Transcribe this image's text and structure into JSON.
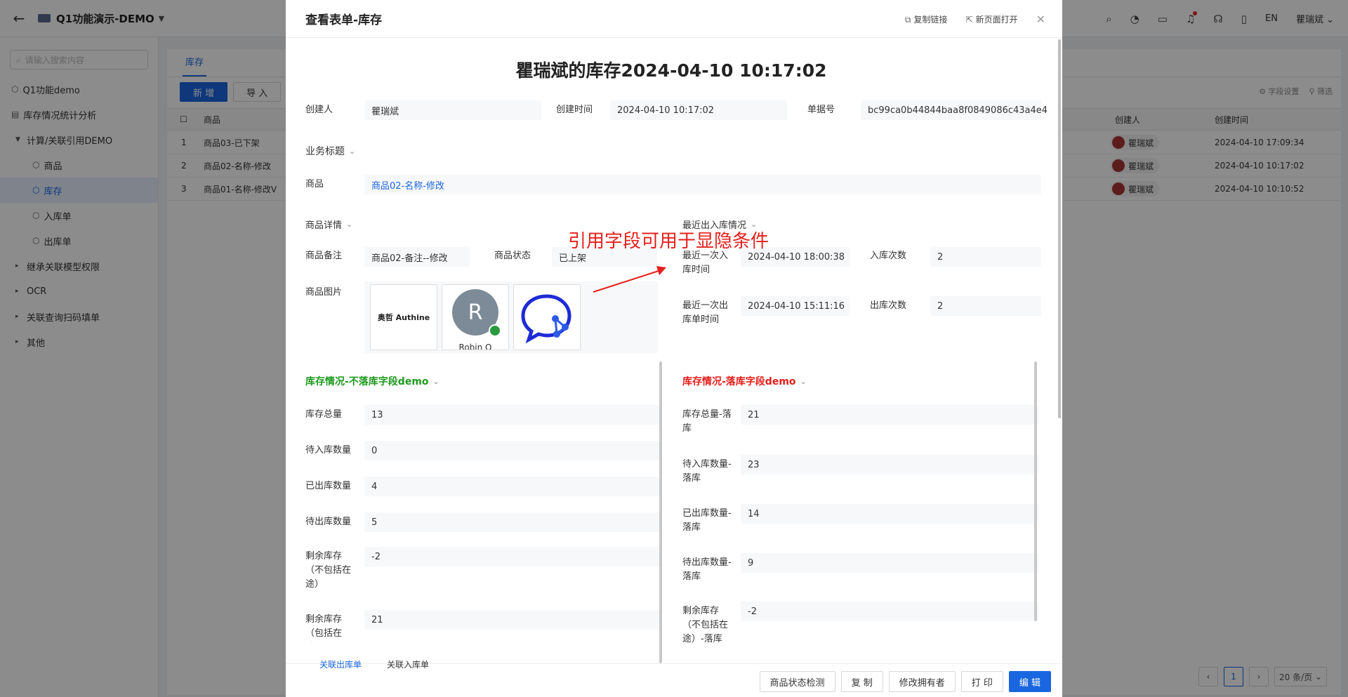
{
  "topbar": {
    "title": "Q1功能演示-DEMO",
    "lang": "EN",
    "user": "瞿瑞斌",
    "icons": [
      "search-icon",
      "dashboard-icon",
      "monitor-icon",
      "bell-icon",
      "headset-icon",
      "book-icon"
    ]
  },
  "sidebar": {
    "search_placeholder": "请输入搜索内容",
    "items": [
      {
        "label": "Q1功能demo"
      },
      {
        "label": "库存情况统计分析"
      },
      {
        "label": "计算/关联引用DEMO"
      },
      {
        "label": "商品"
      },
      {
        "label": "库存"
      },
      {
        "label": "入库单"
      },
      {
        "label": "出库单"
      },
      {
        "label": "继承关联模型权限"
      },
      {
        "label": "OCR"
      },
      {
        "label": "关联查询扫码填单"
      },
      {
        "label": "其他"
      }
    ]
  },
  "list": {
    "tab": "库存",
    "add": "新 增",
    "import": "导 入",
    "field_settings": "字段设置",
    "filter": "筛选",
    "col_product": "商品",
    "col_creator": "创建人",
    "col_created": "创建时间",
    "rows": [
      {
        "no": "1",
        "product": "商品03-已下架",
        "creator": "瞿瑞斌",
        "created": "2024-04-10 17:09:34"
      },
      {
        "no": "2",
        "product": "商品02-名称-修改",
        "creator": "瞿瑞斌",
        "created": "2024-04-10 10:17:02"
      },
      {
        "no": "3",
        "product": "商品01-名称-修改V",
        "creator": "瞿瑞斌",
        "created": "2024-04-10 10:10:52"
      }
    ],
    "page": "1",
    "page_size": "20 条/页"
  },
  "modal": {
    "title": "查看表单-库存",
    "copy_link": "复制链接",
    "open_new": "新页面打开",
    "doc_title": "瞿瑞斌的库存2024-04-10 10:17:02",
    "creator_label": "创建人",
    "creator": "瞿瑞斌",
    "created_label": "创建时间",
    "created": "2024-04-10 10:17:02",
    "docno_label": "单据号",
    "docno": "bc99ca0b44844baa8f0849086c43a4e4",
    "biz_title": "业务标题",
    "product_label": "商品",
    "product": "商品02-名称-修改",
    "product_detail": "商品详情",
    "product_note_label": "商品备注",
    "product_note": "商品02-备注--修改",
    "product_status_label": "商品状态",
    "product_status": "已上架",
    "product_image_label": "商品图片",
    "image_logo_text": "奥哲 Authine",
    "image_avatar_letter": "R",
    "image_avatar_name": "Robin Q",
    "recent_title": "最近出入库情况",
    "last_in_label": "最近一次入库时间",
    "last_in": "2024-04-10 18:00:38",
    "in_count_label": "入库次数",
    "in_count": "2",
    "last_out_label": "最近一次出库单时间",
    "last_out": "2024-04-10 15:11:16",
    "out_count_label": "出库次数",
    "out_count": "2",
    "annotation": "引用字段可用于显隐条件",
    "left_section": "库存情况-不落库字段demo",
    "right_section": "库存情况-落库字段demo",
    "left_fields": [
      {
        "label": "库存总量",
        "value": "13"
      },
      {
        "label": "待入库数量",
        "value": "0"
      },
      {
        "label": "已出库数量",
        "value": "4"
      },
      {
        "label": "待出库数量",
        "value": "5"
      },
      {
        "label": "剩余库存（不包括在途）",
        "value": "-2"
      },
      {
        "label": "剩余库存（包括在途）",
        "value": "21"
      }
    ],
    "right_fields": [
      {
        "label": "库存总量-落库",
        "value": "21"
      },
      {
        "label": "待入库数量-落库",
        "value": "23"
      },
      {
        "label": "已出库数量-落库",
        "value": "14"
      },
      {
        "label": "待出库数量-落库",
        "value": "9"
      },
      {
        "label": "剩余库存（不包括在途）-落库",
        "value": "-2"
      }
    ],
    "subtab1": "关联出库单",
    "subtab2": "关联入库单",
    "footer": {
      "check": "商品状态检测",
      "copy": "复 制",
      "owner": "修改拥有者",
      "print": "打 印",
      "edit": "编 辑"
    }
  },
  "colors": {
    "primary": "#1a66e0",
    "green_section": "#1e9a1e",
    "red_section": "#e5201c"
  }
}
